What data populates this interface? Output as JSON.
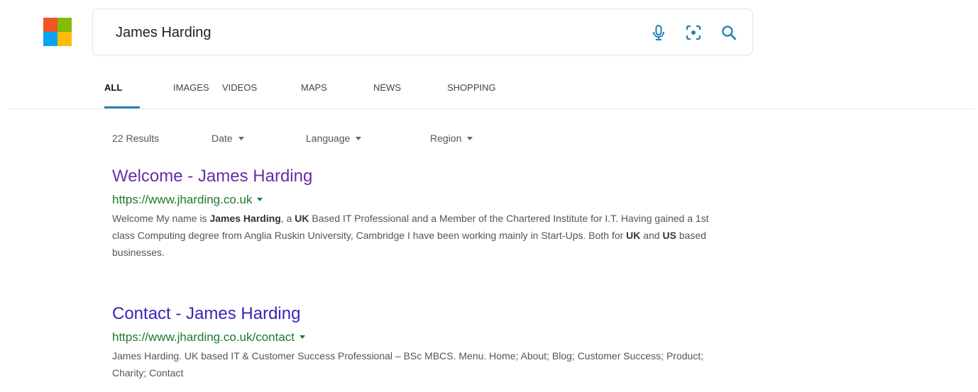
{
  "search": {
    "query": "James Harding"
  },
  "tabs": [
    {
      "label": "ALL",
      "active": true
    },
    {
      "label": "IMAGES"
    },
    {
      "label": "VIDEOS"
    },
    {
      "label": "MAPS"
    },
    {
      "label": "NEWS"
    },
    {
      "label": "SHOPPING"
    }
  ],
  "filters": {
    "results_count": "22 Results",
    "date": "Date",
    "language": "Language",
    "region": "Region"
  },
  "results": [
    {
      "title": "Welcome - James Harding",
      "url": "https://www.jharding.co.uk",
      "snippet_parts": [
        {
          "t": "Welcome My name is "
        },
        {
          "t": "James Harding",
          "b": true
        },
        {
          "t": ", a "
        },
        {
          "t": "UK",
          "b": true
        },
        {
          "t": " Based IT Professional and a Member of the Chartered Institute for I.T. Having gained a 1st class Computing degree from Anglia Ruskin University, Cambridge I have been working mainly in Start-Ups. Both for "
        },
        {
          "t": "UK",
          "b": true
        },
        {
          "t": " and "
        },
        {
          "t": "US",
          "b": true
        },
        {
          "t": " based businesses."
        }
      ]
    },
    {
      "title": "Contact - James Harding",
      "url": "https://www.jharding.co.uk/contact",
      "snippet_parts": [
        {
          "t": "James Harding. UK based IT & Customer Success Professional – BSc MBCS. Menu. Home; About; Blog; Customer Success; Product; Charity; Contact"
        }
      ]
    }
  ],
  "colors": {
    "accent": "#2a7fb4",
    "link": "#3a25b8",
    "visited_link": "#6a2ca5",
    "url_green": "#1d7a2a"
  },
  "icons": [
    "microsoft-logo",
    "mic-icon",
    "visual-search-icon",
    "search-icon",
    "chevron-down-icon"
  ]
}
